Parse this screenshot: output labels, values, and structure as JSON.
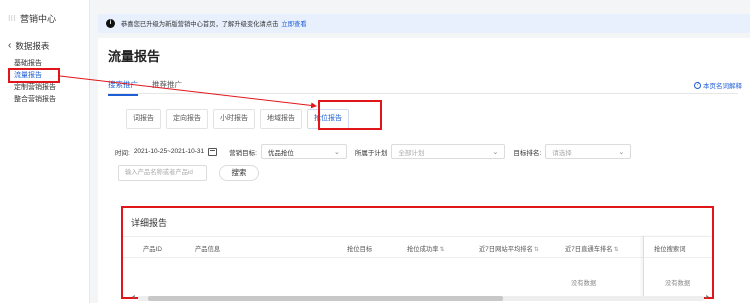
{
  "sidebar": {
    "app_title": "营销中心",
    "back_label": "数据报表",
    "items": [
      {
        "label": "基础报告"
      },
      {
        "label": "流量报告"
      },
      {
        "label": "定制营销报告"
      },
      {
        "label": "整合营销报告"
      }
    ]
  },
  "notice": {
    "text": "恭喜您已升级为新版营销中心首页，了解升级变化请点击",
    "link": "立即查看"
  },
  "page": {
    "title": "流量报告",
    "help": "本页名词解释"
  },
  "tabs": [
    {
      "label": "搜索推广"
    },
    {
      "label": "推荐推广"
    }
  ],
  "report_tabs": [
    {
      "label": "词报告"
    },
    {
      "label": "定向报告"
    },
    {
      "label": "小时报告"
    },
    {
      "label": "地域报告"
    },
    {
      "label": "抢位报告"
    }
  ],
  "filters": {
    "time_label": "时间:",
    "date_range": "2021-10-25~2021-10-31",
    "goal_label": "营销目标:",
    "goal_value": "优品抢位",
    "plan_label": "所属于计划",
    "plan_placeholder": "全部计划",
    "rank_label": "目标排名:",
    "rank_placeholder": "请选择"
  },
  "search": {
    "placeholder": "输入产品名称或者产品id",
    "button": "搜索"
  },
  "detail": {
    "title": "详细报告",
    "columns": [
      {
        "label": "产品ID"
      },
      {
        "label": "产品信息"
      },
      {
        "label": "抢位目标"
      },
      {
        "label": "抢位成功率"
      },
      {
        "label": "近7日网站平均排名"
      },
      {
        "label": "近7日直通车排名"
      },
      {
        "label": "抢位搜索词"
      }
    ],
    "empty_text": "没有数据",
    "empty_text_pinned": "没有数据"
  },
  "colors": {
    "accent": "#1f5fd6",
    "highlight": "#e0161a"
  }
}
